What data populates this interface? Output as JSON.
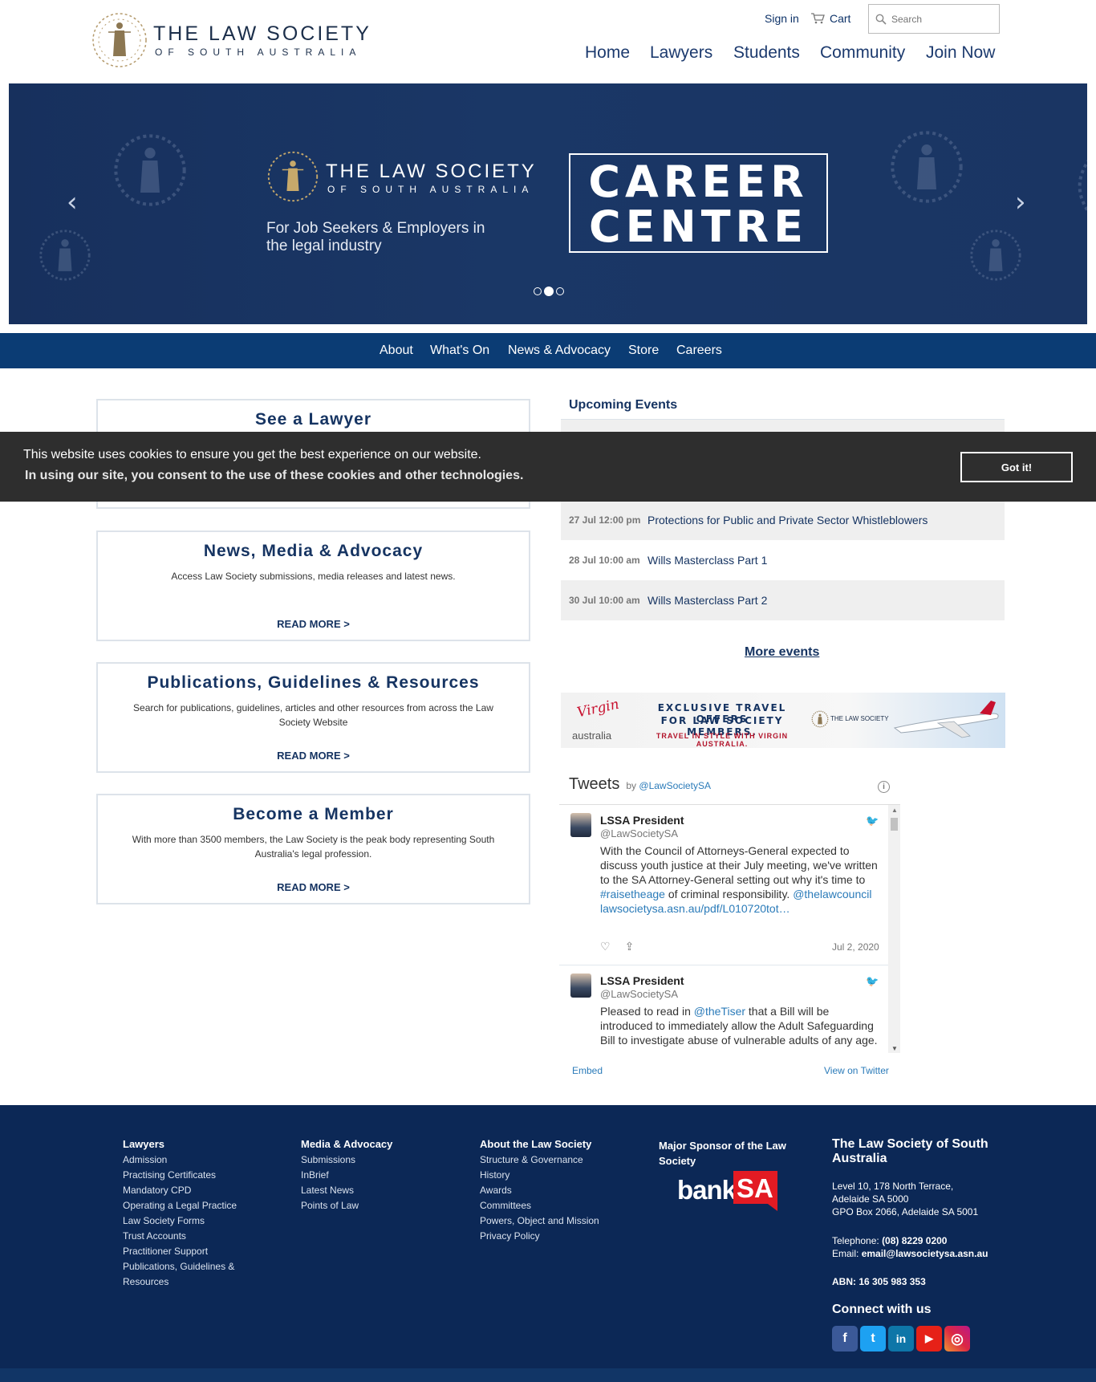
{
  "header": {
    "logo_title": "THE LAW SOCIETY",
    "logo_subtitle": "OF SOUTH AUSTRALIA",
    "signin": "Sign in",
    "cart": "Cart",
    "search_placeholder": "Search",
    "nav": [
      "Home",
      "Lawyers",
      "Students",
      "Community",
      "Join Now"
    ]
  },
  "hero": {
    "logo_title": "THE LAW SOCIETY",
    "logo_subtitle": "OF SOUTH AUSTRALIA",
    "tagline": "For Job Seekers & Employers in the legal industry",
    "career_line1": "CAREER",
    "career_line2": "CENTRE",
    "prev": "‹",
    "next": "›",
    "slide_count": 3,
    "active_slide": 2
  },
  "subnav": [
    "About",
    "What's On",
    "News & Advocacy",
    "Store",
    "Careers"
  ],
  "cards": [
    {
      "title": "See a Lawyer",
      "desc": "",
      "link": ""
    },
    {
      "title": "News, Media & Advocacy",
      "desc": "Access Law Society submissions, media releases and latest news.",
      "link": "READ MORE >"
    },
    {
      "title": "Publications, Guidelines & Resources",
      "desc": "Search for publications, guidelines, articles and other resources from across the Law Society Website",
      "link": "READ MORE >"
    },
    {
      "title": "Become a Member",
      "desc": "With more than 3500 members, the Law Society is the peak body representing South Australia's legal profession.",
      "link": "READ MORE >"
    }
  ],
  "events": {
    "title": "Upcoming Events",
    "items": [
      {
        "date": "27 Jul 12:00 pm",
        "name": "Protections for Public and Private Sector Whistleblowers"
      },
      {
        "date": "28 Jul 10:00 am",
        "name": "Wills Masterclass Part 1"
      },
      {
        "date": "30 Jul 10:00 am",
        "name": "Wills Masterclass Part 2"
      }
    ],
    "more": "More events"
  },
  "ad": {
    "brand": "Virgin",
    "brand_sub": "australia",
    "line1": "EXCLUSIVE TRAVEL OFFERS",
    "line2": "FOR LAW SOCIETY MEMBERS.",
    "line3": "TRAVEL IN STYLE WITH VIRGIN AUSTRALIA.",
    "logo": "THE LAW SOCIETY"
  },
  "twitter": {
    "title": "Tweets",
    "by": "by",
    "handle": "@LawSocietySA",
    "info": "i",
    "tweets": [
      {
        "name": "LSSA President",
        "handle": "@LawSocietySA",
        "text_a": "With the Council of Attorneys-General expected to discuss youth justice at their July meeting, we've written to the SA Attorney-General setting out why it's time to ",
        "link1": "#raisetheage",
        "text_b": " of criminal responsibility. ",
        "link2": "@thelawcouncil",
        "link3": "lawsocietysa.asn.au/pdf/L010720tot…",
        "date": "Jul 2, 2020"
      },
      {
        "name": "LSSA President",
        "handle": "@LawSocietySA",
        "text_a": "Pleased to read in ",
        "link1": "@theTiser",
        "text_b": " that a Bill will be introduced to immediately allow the Adult Safeguarding Bill to investigate abuse of vulnerable adults of any age."
      }
    ],
    "embed": "Embed",
    "view": "View on Twitter"
  },
  "cookie": {
    "line1": "This website uses cookies to ensure you get the best experience on our website.",
    "line2": "In using our site, you consent to the use of these cookies and other technologies.",
    "button": "Got it!"
  },
  "footer": {
    "columns": [
      {
        "title": "Lawyers",
        "links": [
          "Admission",
          "Practising Certificates",
          "Mandatory CPD",
          "Operating a Legal Practice",
          "Law Society Forms",
          "Trust Accounts",
          "Practitioner Support",
          "Publications, Guidelines &",
          "Resources"
        ]
      },
      {
        "title": "Media & Advocacy",
        "links": [
          "Submissions",
          "InBrief",
          "Latest News",
          "Points of Law"
        ]
      },
      {
        "title": "About the Law Society",
        "links": [
          "Structure & Governance",
          "History",
          "Awards",
          "Committees",
          "Powers, Object and Mission",
          "Privacy Policy"
        ]
      }
    ],
    "sponsor_title": "Major Sponsor of the Law Society",
    "sponsor_bank": "bank",
    "sponsor_sa": "SA",
    "contact_title": "The Law Society of South Australia",
    "address1": "Level 10, 178 North Terrace,",
    "address2": "Adelaide SA 5000",
    "address3": "GPO Box 2066, Adelaide SA 5001",
    "phone_label": "Telephone: ",
    "phone": "(08) 8229 0200",
    "email_label": "Email: ",
    "email": "email@lawsocietysa.asn.au",
    "abn": "ABN: 16 305 983 353",
    "connect": "Connect with us",
    "social": [
      {
        "name": "facebook",
        "glyph": "f",
        "color": "#3b5998"
      },
      {
        "name": "twitter",
        "glyph": "t",
        "color": "#1da1f2"
      },
      {
        "name": "linkedin",
        "glyph": "in",
        "color": "#0e76a8"
      },
      {
        "name": "youtube",
        "glyph": "▶",
        "color": "#e62117"
      },
      {
        "name": "instagram",
        "glyph": "◎",
        "color": "#c13584"
      }
    ]
  }
}
